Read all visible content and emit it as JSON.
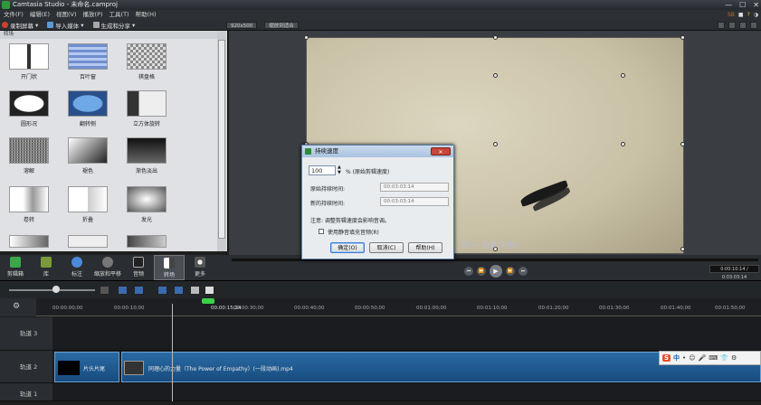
{
  "window": {
    "title": "Camtasia Studio - 未命名.camproj",
    "controls": [
      "—",
      "☐",
      "✕"
    ]
  },
  "menu": [
    "文件(F)",
    "编辑(E)",
    "视图(V)",
    "播放(P)",
    "工具(T)",
    "帮助(H)"
  ],
  "menu_right": [
    "SB",
    "■",
    "?",
    "◑"
  ],
  "toolbar": {
    "record": "录制屏幕",
    "import": "导入媒体",
    "produce": "生成和分享",
    "canvas_size": "920x500",
    "zoom": "缩放到适合"
  },
  "left_panel": {
    "header": "转场",
    "tiles": [
      {
        "label": "开门状"
      },
      {
        "label": "百叶窗"
      },
      {
        "label": "棋盘格"
      },
      {
        "label": "圆形况"
      },
      {
        "label": "翻转侧"
      },
      {
        "label": "立方体旋转"
      },
      {
        "label": "溶解"
      },
      {
        "label": "褪色"
      },
      {
        "label": "渐色淡出"
      },
      {
        "label": "卷转"
      },
      {
        "label": "折叠"
      },
      {
        "label": "发光"
      }
    ]
  },
  "tools": [
    {
      "label": "剪辑箱"
    },
    {
      "label": "库"
    },
    {
      "label": "标注"
    },
    {
      "label": "缩放和平移"
    },
    {
      "label": "音频"
    },
    {
      "label": "转场"
    },
    {
      "label": "更多"
    }
  ],
  "preview": {
    "caption": "我们一起来·同理心",
    "timecode": "0:00:10:14 / 0:03:03:14"
  },
  "playback": {
    "buttons": [
      "⏮",
      "⏪",
      "▶",
      "⏩",
      "⏭"
    ]
  },
  "timeline": {
    "ruler": [
      "00:00:00;00",
      "00:00:10;00",
      "00:00:20;00",
      "00:00:30;00",
      "00:00:40;00",
      "00:00:50;00",
      "00:01:00;00",
      "00:01:10;00",
      "00:01:20;00",
      "00:01:30;00",
      "00:01:40;00",
      "00:01:50;00"
    ],
    "playhead": "00:00:15;24",
    "tracks": [
      {
        "label": "轨道 3"
      },
      {
        "label": "轨道 2"
      },
      {
        "label": "轨道 1"
      }
    ],
    "clips": [
      {
        "label": "片头片尾"
      },
      {
        "label": "同理心的力量（The Power of Empathy）(一段动画).mp4"
      }
    ]
  },
  "ime": {
    "logo": "S",
    "mode": "中",
    "icons": [
      "•",
      "☺",
      "🎤",
      "⌨",
      "👕",
      "⚙"
    ]
  },
  "dialog": {
    "title": "持续速度",
    "close": "✕",
    "value": "100",
    "percent_label": "% (原始剪辑速度)",
    "original_duration_label": "原始持续时间:",
    "original_duration": "00:03:03:14",
    "new_duration_label": "新的持续时间:",
    "new_duration": "00:03:03:14",
    "note": "注意: 调整剪辑速度会影响音调。",
    "checkbox_label": "使用静音填充音频(R)",
    "buttons": {
      "ok": "确定(O)",
      "cancel": "取消(C)",
      "help": "帮助(H)"
    }
  }
}
